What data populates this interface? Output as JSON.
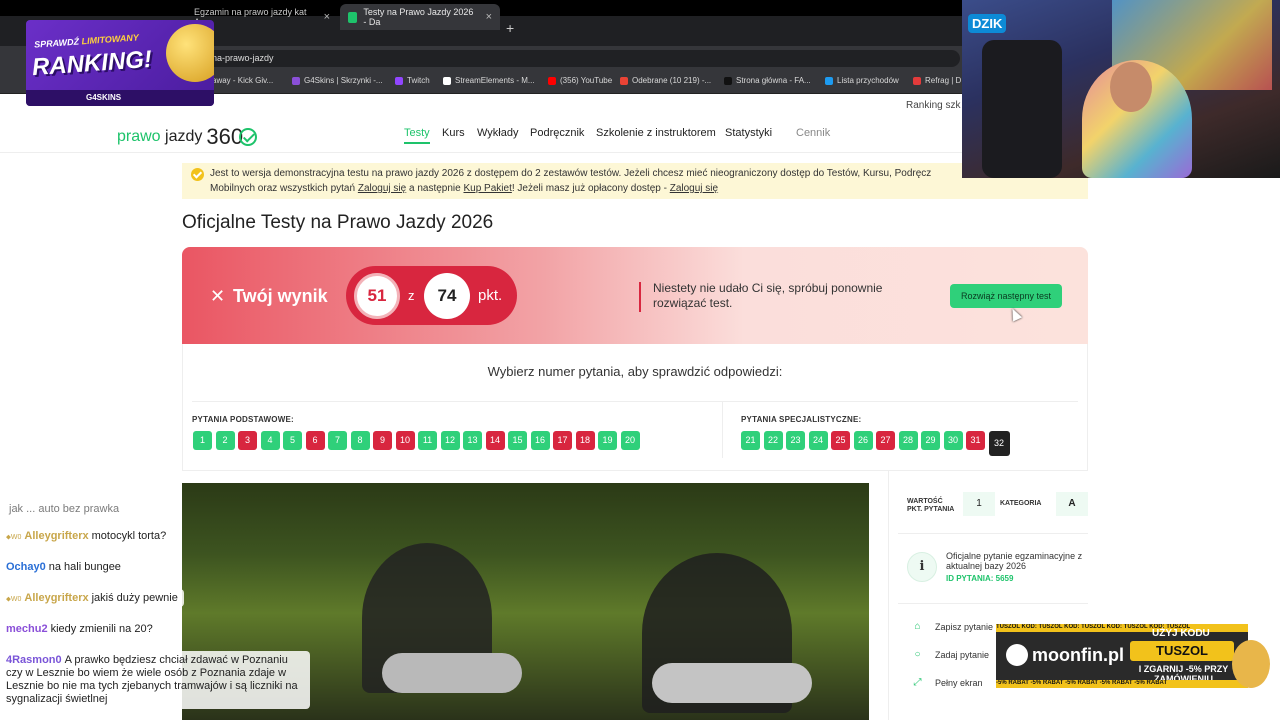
{
  "browser": {
    "tabs": [
      {
        "label": "Egzamin na prawo jazdy kat A ..."
      },
      {
        "label": "Testy na Prawo Jazdy 2026 - Da"
      }
    ],
    "url": "na-prawo-jazdy",
    "bookmarks": [
      {
        "label": "away - Kick Giv...",
        "color": "#1ec36b"
      },
      {
        "label": "G4Skins | Skrzynki -...",
        "color": "#8a4fd8"
      },
      {
        "label": "Twitch",
        "color": "#9146ff"
      },
      {
        "label": "StreamElements - M...",
        "color": "#ffffff"
      },
      {
        "label": "(356) YouTube",
        "color": "#ff0000"
      },
      {
        "label": "Odebrane (10 219) -...",
        "color": "#ea4335"
      },
      {
        "label": "Strona główna - FA...",
        "color": "#111111"
      },
      {
        "label": "Lista przychodów",
        "color": "#1d9bf0"
      },
      {
        "label": "Refrag | D",
        "color": "#e33b3b"
      }
    ]
  },
  "promo": {
    "line1_a": "SPRAWDŹ",
    "line1_b": "LIMITOWANY",
    "line2": "RANKING!",
    "footer": "G4SKINS"
  },
  "webcam": {
    "logo": "DZIK"
  },
  "site": {
    "ranking_link": "Ranking szk",
    "brand_a": "prawo",
    "brand_b": "jazdy",
    "brand_num": "360",
    "nav": [
      "Testy",
      "Kurs",
      "Wykłady",
      "Podręcznik",
      "Szkolenie z instruktorem",
      "Statystyki",
      "Cennik"
    ]
  },
  "notice": {
    "text1": "Jest to wersja demonstracyjna testu na prawo jazdy 2026 z dostępem do 2 zestawów testów. Jeżeli chcesz mieć nieograniczony dostęp do Testów, Kursu, Podręcz",
    "text2a": "Mobilnych oraz wszystkich pytań",
    "link_login": "Zaloguj się",
    "text2b": "a następnie",
    "link_buy": "Kup Pakiet",
    "text2c": "! Jeżeli masz już opłacony dostęp -",
    "link_login2": "Zaloguj się"
  },
  "page_title": "Oficjalne Testy na Prawo Jazdy 2026",
  "result": {
    "label": "Twój wynik",
    "score": "51",
    "of": "z",
    "max": "74",
    "unit": "pkt.",
    "message": "Niestety nie udało Ci się, spróbuj ponownie rozwiązać test.",
    "next_button": "Rozwiąż następny test"
  },
  "questions": {
    "prompt": "Wybierz numer pytania, aby sprawdzić odpowiedzi:",
    "basic_label": "PYTANIA PODSTAWOWE:",
    "special_label": "PYTANIA SPECJALISTYCZNE:",
    "basic": [
      {
        "n": "1",
        "s": "ok"
      },
      {
        "n": "2",
        "s": "ok"
      },
      {
        "n": "3",
        "s": "bad"
      },
      {
        "n": "4",
        "s": "ok"
      },
      {
        "n": "5",
        "s": "ok"
      },
      {
        "n": "6",
        "s": "bad"
      },
      {
        "n": "7",
        "s": "ok"
      },
      {
        "n": "8",
        "s": "ok"
      },
      {
        "n": "9",
        "s": "bad"
      },
      {
        "n": "10",
        "s": "bad"
      },
      {
        "n": "11",
        "s": "ok"
      },
      {
        "n": "12",
        "s": "ok"
      },
      {
        "n": "13",
        "s": "ok"
      },
      {
        "n": "14",
        "s": "bad"
      },
      {
        "n": "15",
        "s": "ok"
      },
      {
        "n": "16",
        "s": "ok"
      },
      {
        "n": "17",
        "s": "bad"
      },
      {
        "n": "18",
        "s": "bad"
      },
      {
        "n": "19",
        "s": "ok"
      },
      {
        "n": "20",
        "s": "ok"
      }
    ],
    "special": [
      {
        "n": "21",
        "s": "ok"
      },
      {
        "n": "22",
        "s": "ok"
      },
      {
        "n": "23",
        "s": "ok"
      },
      {
        "n": "24",
        "s": "ok"
      },
      {
        "n": "25",
        "s": "bad"
      },
      {
        "n": "26",
        "s": "ok"
      },
      {
        "n": "27",
        "s": "bad"
      },
      {
        "n": "28",
        "s": "ok"
      },
      {
        "n": "29",
        "s": "ok"
      },
      {
        "n": "30",
        "s": "ok"
      },
      {
        "n": "31",
        "s": "bad"
      },
      {
        "n": "32",
        "s": "cur"
      }
    ]
  },
  "panel": {
    "points_label": "WARTOŚĆ PKT. PYTANIA",
    "points_value": "1",
    "category_label": "KATEGORIA",
    "category_value": "A",
    "info_icon": "i",
    "info_text": "Oficjalne pytanie egzaminacyjne z aktualnej bazy 2026",
    "info_id": "ID PYTANIA: 5659",
    "actions": [
      "Zapisz pytanie",
      "Zadaj pytanie",
      "Pełny ekran"
    ]
  },
  "chat": [
    {
      "user": "",
      "text": "jak ... auto bez prawka"
    },
    {
      "user": "Alleygrifterx",
      "text": "motocykl torta?",
      "badge": "⬥W0"
    },
    {
      "user": "Ochay0",
      "text": "na hali bungee"
    },
    {
      "user": "Alleygrifterx",
      "text": "jakiś duży pewnie",
      "badge": "⬥W0"
    },
    {
      "user": "mechu2",
      "text": "kiedy zmienili na 20?"
    },
    {
      "user": "4Rasmon0",
      "text": "A prawko będziesz chciał zdawać w Poznaniu czy w Lesznie bo wiem że wiele osób z Poznania zdaje w Lesznie bo nie ma tych zjebanych tramwajów i są liczniki na sygnalizacji świetlnej"
    }
  ],
  "ad": {
    "brand": "moonfin.pl",
    "code_title": "UŻYJ KODU",
    "code": "TUSZOL",
    "code_sub": "I ZGARNIJ -5% PRZY ZAMÓWIENIU",
    "strip_top": "TUSZOL KOD: TUSZOL KOD: TUSZOL KOD: TUSZOL KOD: TUSZOL",
    "strip_bottom": "-5% RABAT -5% RABAT -5% RABAT -5% RABAT -5% RABAT"
  }
}
